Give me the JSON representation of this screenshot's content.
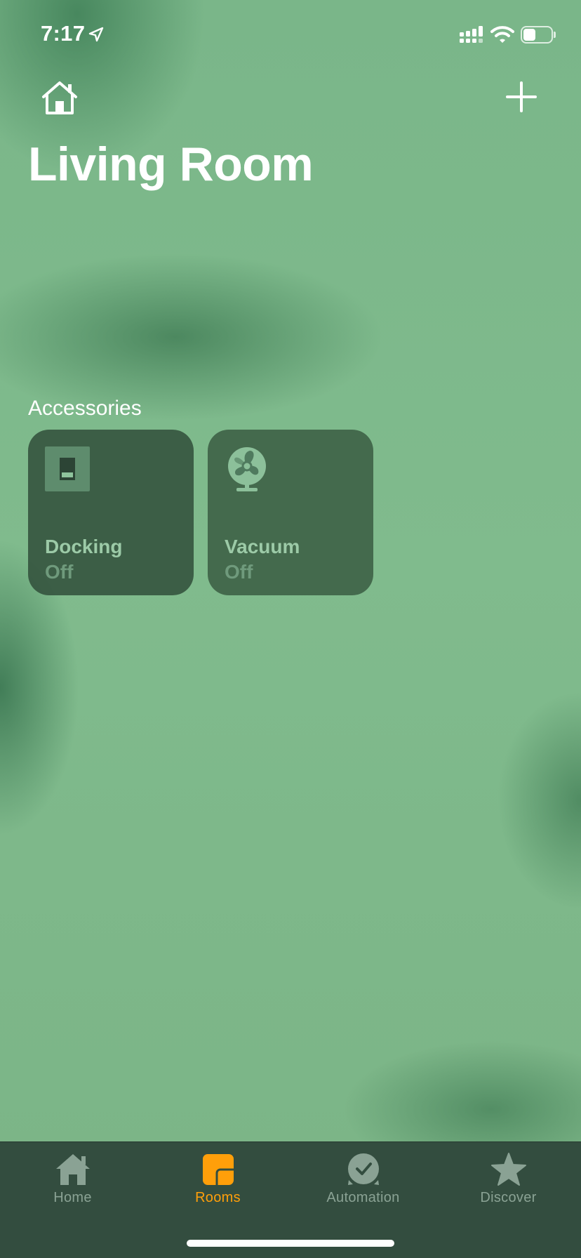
{
  "status_bar": {
    "time": "7:17",
    "icons": [
      "location-arrow-icon",
      "cellular-signal-icon",
      "wifi-icon",
      "battery-icon"
    ],
    "battery_level": 0.45
  },
  "header": {
    "home_icon": "house-icon",
    "add_icon": "plus-icon",
    "title": "Living Room"
  },
  "accessories": {
    "section_title": "Accessories",
    "items": [
      {
        "name": "Docking",
        "state": "Off",
        "icon": "switch-icon"
      },
      {
        "name": "Vacuum",
        "state": "Off",
        "icon": "fan-icon"
      }
    ]
  },
  "tab_bar": {
    "active_index": 1,
    "active_color": "#ff9f0a",
    "inactive_color": "#8aa294",
    "tabs": [
      {
        "label": "Home",
        "icon": "house-fill-icon"
      },
      {
        "label": "Rooms",
        "icon": "rooms-icon"
      },
      {
        "label": "Automation",
        "icon": "clock-check-icon"
      },
      {
        "label": "Discover",
        "icon": "star-icon"
      }
    ]
  },
  "colors": {
    "background": "#7db98a",
    "tile_name": "#9ccaa7",
    "tile_state": "#6f9a7c",
    "tab_bar": "#334d3f"
  }
}
